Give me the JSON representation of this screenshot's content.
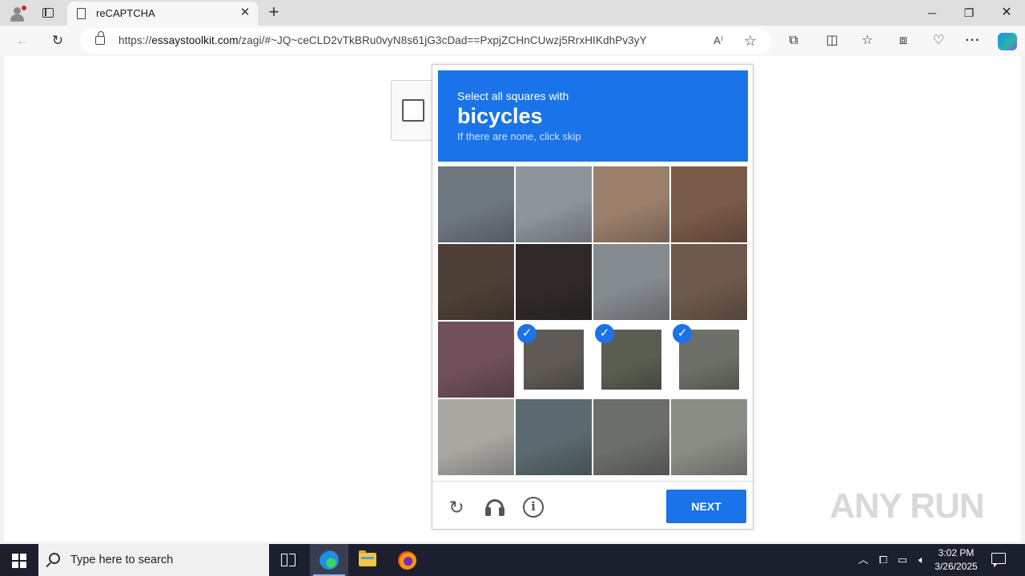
{
  "browser": {
    "tab_title": "reCAPTCHA",
    "url_scheme": "https://",
    "url_host": "essaystoolkit.com",
    "url_path": "/zagi/#~JQ~ceCLD2vTkBRu0vyN8s61jG3cDad==PxpjZCHnCUwzj5RrxHIKdhPv3yY"
  },
  "captcha": {
    "instruction": "Select all squares with",
    "target": "bicycles",
    "hint": "If there are none, click skip",
    "next_label": "NEXT",
    "selected_tiles": [
      9,
      10,
      11
    ],
    "tile_colors": [
      [
        "#6f7780",
        "#8d949a",
        "#9a7f6a",
        "#7a5a48"
      ],
      [
        "#4e4036",
        "#2f2a28",
        "#858a8e",
        "#6e5a4c"
      ],
      [
        "#70505a",
        "#5f5a55",
        "#5a5e52",
        "#6d7068"
      ],
      [
        "#a9a7a2",
        "#5b6a6e",
        "#6c6e6a",
        "#8a8d86"
      ]
    ]
  },
  "watermark": {
    "text": "ANY RUN"
  },
  "taskbar": {
    "search_placeholder": "Type here to search",
    "time": "3:02 PM",
    "date": "3/26/2025"
  },
  "icons": {
    "back": "back-arrow-icon",
    "reload": "reload-icon",
    "lock": "lock-icon",
    "read_aloud": "read-aloud-icon",
    "favorite": "star-icon",
    "extensions": "puzzle-icon",
    "split": "split-screen-icon",
    "favorites": "favorites-icon",
    "collections": "collections-icon",
    "performance": "heart-pulse-icon",
    "more": "more-icon",
    "copilot": "copilot-icon"
  }
}
